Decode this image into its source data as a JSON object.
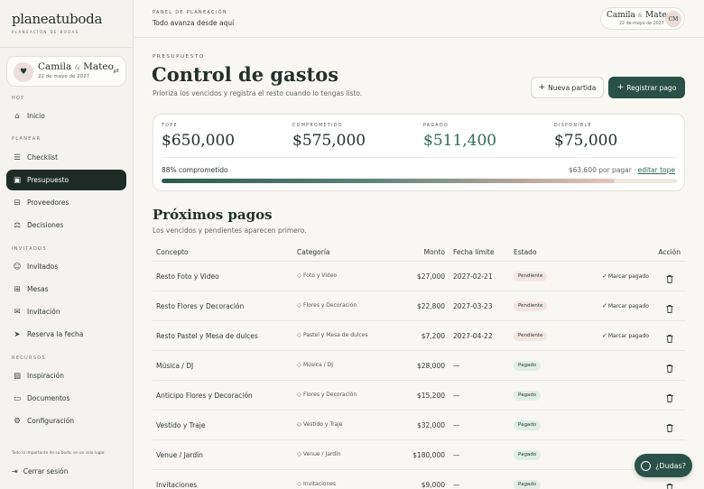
{
  "sidebar": {
    "brand": "planeatuboda",
    "brand_sub": "Planeación de bodas",
    "couple": {
      "name1": "Camila",
      "amp": "&",
      "name2": "Mateo",
      "date": "22 de mayo de 2027"
    },
    "sections": {
      "hoy": "Hoy",
      "planear": "Planear",
      "invitados": "Invitados",
      "recursos": "Recursos"
    },
    "items": {
      "inicio": "Inicio",
      "checklist": "Checklist",
      "presupuesto": "Presupuesto",
      "proveedores": "Proveedores",
      "decisiones": "Decisiones",
      "invitados": "Invitados",
      "mesas": "Mesas",
      "invitacion": "Invitación",
      "reserva": "Reserva la fecha",
      "inspiracion": "Inspiración",
      "documentos": "Documentos",
      "configuracion": "Configuración"
    },
    "footer_note": "Todo lo importante de su boda, en un solo lugar.",
    "logout": "Cerrar sesión"
  },
  "topbar": {
    "eyebrow": "Panel de planeación",
    "text": "Todo avanza desde aquí",
    "couple": {
      "name1": "Camila",
      "amp": "&",
      "name2": "Mateo",
      "date": "22 de mayo de 2027",
      "initials": "CM"
    }
  },
  "header": {
    "eyebrow": "Presupuesto",
    "title": "Control de gastos",
    "subtitle": "Prioriza los vencidos y registra el resto cuando lo tengas listo.",
    "btn_new": "Nueva partida",
    "btn_pay": "Registrar pago"
  },
  "budget": {
    "tope_label": "Tope",
    "tope_value": "$650,000",
    "comp_label": "Comprometido",
    "comp_value": "$575,000",
    "pagado_label": "Pagado",
    "pagado_value": "$511,400",
    "disp_label": "Disponible",
    "disp_value": "$75,000",
    "percent_text": "88% comprometido",
    "pending_text": "$63,600 por pagar ·",
    "edit_link": "editar tope",
    "progress_fraction": 0.88
  },
  "payments": {
    "title": "Próximos pagos",
    "subtitle": "Los vencidos y pendientes aparecen primero.",
    "headers": {
      "concepto": "Concepto",
      "categoria": "Categoría",
      "monto": "Monto",
      "fecha": "Fecha límite",
      "estado": "Estado",
      "accion": "Acción"
    },
    "mark_label": "Marcar pagado",
    "rows": [
      {
        "concepto": "Resto Foto y Video",
        "categoria": "Foto y Video",
        "monto": "$27,000",
        "fecha": "2027-02-21",
        "estado": "Pendiente"
      },
      {
        "concepto": "Resto Flores y Decoración",
        "categoria": "Flores y Decoración",
        "monto": "$22,800",
        "fecha": "2027-03-23",
        "estado": "Pendiente"
      },
      {
        "concepto": "Resto Pastel y Mesa de dulces",
        "categoria": "Pastel y Mesa de dulces",
        "monto": "$7,200",
        "fecha": "2027-04-22",
        "estado": "Pendiente"
      },
      {
        "concepto": "Música / DJ",
        "categoria": "Música / DJ",
        "monto": "$28,000",
        "fecha": "—",
        "estado": "Pagado"
      },
      {
        "concepto": "Anticipo Flores y Decoración",
        "categoria": "Flores y Decoración",
        "monto": "$15,200",
        "fecha": "—",
        "estado": "Pagado"
      },
      {
        "concepto": "Vestido y Traje",
        "categoria": "Vestido y Traje",
        "monto": "$32,000",
        "fecha": "—",
        "estado": "Pagado"
      },
      {
        "concepto": "Venue / Jardín",
        "categoria": "Venue / Jardín",
        "monto": "$180,000",
        "fecha": "—",
        "estado": "Pagado"
      },
      {
        "concepto": "Invitaciones",
        "categoria": "Invitaciones",
        "monto": "$9,000",
        "fecha": "—",
        "estado": "Pagado"
      }
    ]
  },
  "help": {
    "label": "¿Dudas?"
  },
  "colors": {
    "primary": "#2a5148",
    "dark": "#1f2b27",
    "pending_bg": "#f3e6e1",
    "paid_bg": "#e1eee6"
  }
}
